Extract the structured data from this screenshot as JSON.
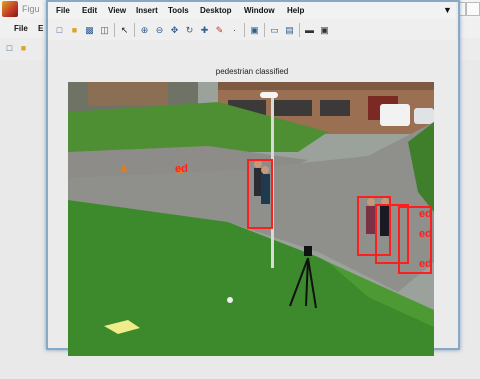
{
  "window1": {
    "title_partial": "Figu",
    "menu": [
      "File",
      "E"
    ]
  },
  "window2": {
    "menu": [
      "File",
      "Edit",
      "View",
      "Insert",
      "Tools",
      "Desktop",
      "Window",
      "Help"
    ],
    "plot_title": "pedestrian classified"
  },
  "icons": {
    "toolbar": [
      "new-figure-icon",
      "open-file-icon",
      "save-icon",
      "print-icon",
      "pointer-icon",
      "zoom-in-icon",
      "zoom-out-icon",
      "pan-icon",
      "rotate-icon",
      "data-cursor-icon",
      "brush-icon",
      "link-icon",
      "colorbar-icon",
      "legend-icon",
      "hide-plot-tools-icon",
      "show-plot-tools-icon"
    ]
  },
  "detections": {
    "labels": [
      "ed",
      "ed",
      "ed",
      "ed"
    ]
  },
  "colors": {
    "detection": "#ff1e1e",
    "window_border": "#86a9c8",
    "grass": "#3d8a2c",
    "road": "#8f8f8c"
  }
}
